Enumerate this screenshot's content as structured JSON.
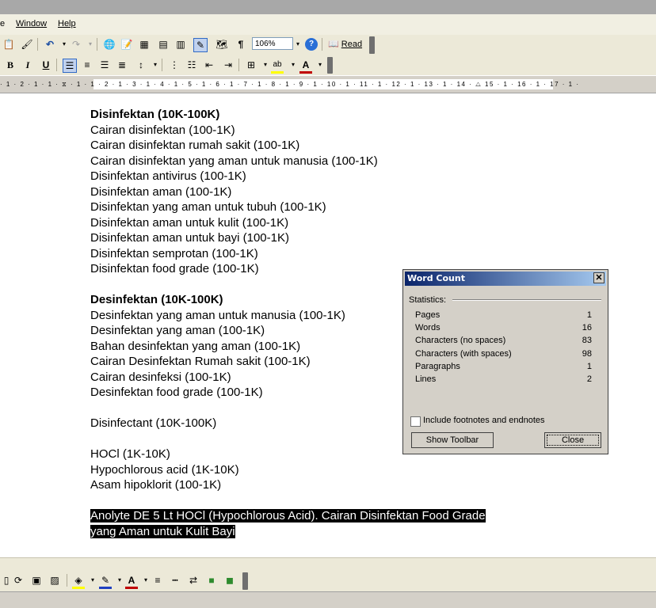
{
  "menu": {
    "items": [
      "e",
      "Window",
      "Help"
    ]
  },
  "toolbar": {
    "zoom": "106%",
    "read_label": "Read"
  },
  "ruler": {
    "ticks": "· 1 · 2 · 1 · 1 · ⧖ · 1 · 1 · 2 · 1 · 3 · 1 · 4 · 1 · 5 · 1 · 6 · 1 · 7 · 1 · 8 · 1 · 9 · 1 · 10 · 1 · 11 · 1 · 12 · 1 · 13 · 1 · 14 · △ 15 · 1 · 16 · 1 · 17 · 1 ·"
  },
  "document": {
    "lines": [
      {
        "text": "Disinfektan (10K-100K)",
        "bold": true
      },
      {
        "text": "Cairan disinfektan (100-1K)"
      },
      {
        "text": "Cairan disinfektan rumah sakit (100-1K)"
      },
      {
        "text": "Cairan disinfektan yang aman untuk manusia (100-1K)"
      },
      {
        "text": "Disinfektan antivirus (100-1K)"
      },
      {
        "text": "Disinfektan aman (100-1K)"
      },
      {
        "text": "Disinfektan yang aman untuk tubuh (100-1K)"
      },
      {
        "text": "Disinfektan aman untuk kulit (100-1K)"
      },
      {
        "text": "Disinfektan aman untuk bayi (100-1K)"
      },
      {
        "text": "Disinfektan semprotan (100-1K)"
      },
      {
        "text": "Disinfektan food grade (100-1K)"
      },
      {
        "text": ""
      },
      {
        "text": "Desinfektan (10K-100K)",
        "bold": true
      },
      {
        "text": "Desinfektan yang aman untuk manusia (100-1K)"
      },
      {
        "text": "Desinfektan yang aman (100-1K)"
      },
      {
        "text": "Bahan desinfektan yang aman (100-1K)"
      },
      {
        "text": "Cairan Desinfektan Rumah sakit (100-1K)"
      },
      {
        "text": "Cairan desinfeksi (100-1K)"
      },
      {
        "text": "Desinfektan food grade (100-1K)"
      },
      {
        "text": ""
      },
      {
        "text": "Disinfectant (10K-100K)"
      },
      {
        "text": ""
      },
      {
        "text": "HOCl (1K-10K)"
      },
      {
        "text": "Hypochlorous acid (1K-10K)"
      },
      {
        "text": "Asam hipoklorit (100-1K)"
      },
      {
        "text": ""
      },
      {
        "text": "Anolyte DE 5 Lt HOCl (Hypochlorous Acid). Cairan Disinfektan Food Grade ",
        "selected": true
      },
      {
        "text": "yang Aman untuk Kulit Bayi ",
        "selected": true
      }
    ]
  },
  "dialog": {
    "title": "Word Count",
    "close_glyph": "✕",
    "stats_heading": "Statistics:",
    "stats": [
      {
        "label": "Pages",
        "value": "1"
      },
      {
        "label": "Words",
        "value": "16"
      },
      {
        "label": "Characters (no spaces)",
        "value": "83"
      },
      {
        "label": "Characters (with spaces)",
        "value": "98"
      },
      {
        "label": "Paragraphs",
        "value": "1"
      },
      {
        "label": "Lines",
        "value": "2"
      }
    ],
    "checkbox_label": "Include footnotes and endnotes",
    "checkbox_checked": false,
    "show_toolbar": "Show Toolbar",
    "close_label": "Close"
  },
  "colors": {
    "title_start": "#0a246a",
    "title_end": "#a6caf0",
    "chrome": "#ece9d8"
  },
  "icons": {
    "toolbar1": [
      "paste-icon",
      "format-painter-icon",
      "undo-icon",
      "redo-icon",
      "hyperlink-icon",
      "tables-borders-icon",
      "insert-table-icon",
      "insert-excel-icon",
      "columns-icon",
      "drawing-icon",
      "document-map-icon",
      "show-hide-icon",
      "help-icon",
      "read-icon"
    ],
    "toolbar2": [
      "bold-icon",
      "italic-icon",
      "underline-icon",
      "align-left-icon",
      "center-icon",
      "align-right-icon",
      "justify-icon",
      "line-spacing-icon",
      "numbering-icon",
      "bullets-icon",
      "decrease-indent-icon",
      "increase-indent-icon",
      "border-icon",
      "highlight-icon",
      "font-color-icon"
    ]
  }
}
